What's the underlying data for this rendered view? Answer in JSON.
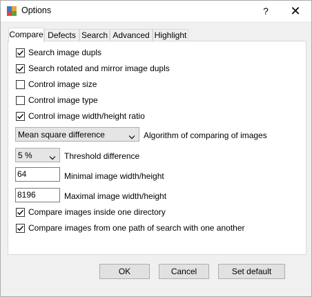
{
  "window": {
    "title": "Options",
    "help_label": "?",
    "close_label": "✕"
  },
  "tabs": [
    {
      "label": "Compare",
      "active": true
    },
    {
      "label": "Defects",
      "active": false
    },
    {
      "label": "Search",
      "active": false
    },
    {
      "label": "Advanced",
      "active": false
    },
    {
      "label": "Highlight",
      "active": false
    }
  ],
  "compare": {
    "options": [
      {
        "label": "Search image dupls",
        "checked": true
      },
      {
        "label": "Search rotated and mirror image dupls",
        "checked": true
      },
      {
        "label": "Control image size",
        "checked": false
      },
      {
        "label": "Control image type",
        "checked": false
      },
      {
        "label": "Control image width/height ratio",
        "checked": true
      }
    ],
    "algorithm": {
      "value": "Mean square difference",
      "label": "Algorithm of comparing of images"
    },
    "threshold": {
      "value": "5 %",
      "label": "Threshold difference"
    },
    "min_size": {
      "value": "64",
      "label": "Minimal image width/height"
    },
    "max_size": {
      "value": "8196",
      "label": "Maximal image width/height"
    },
    "extra_options": [
      {
        "label": "Compare images inside one directory",
        "checked": true
      },
      {
        "label": "Compare images from one path of search with one another",
        "checked": true
      }
    ]
  },
  "buttons": {
    "ok": "OK",
    "cancel": "Cancel",
    "set_default": "Set default"
  }
}
